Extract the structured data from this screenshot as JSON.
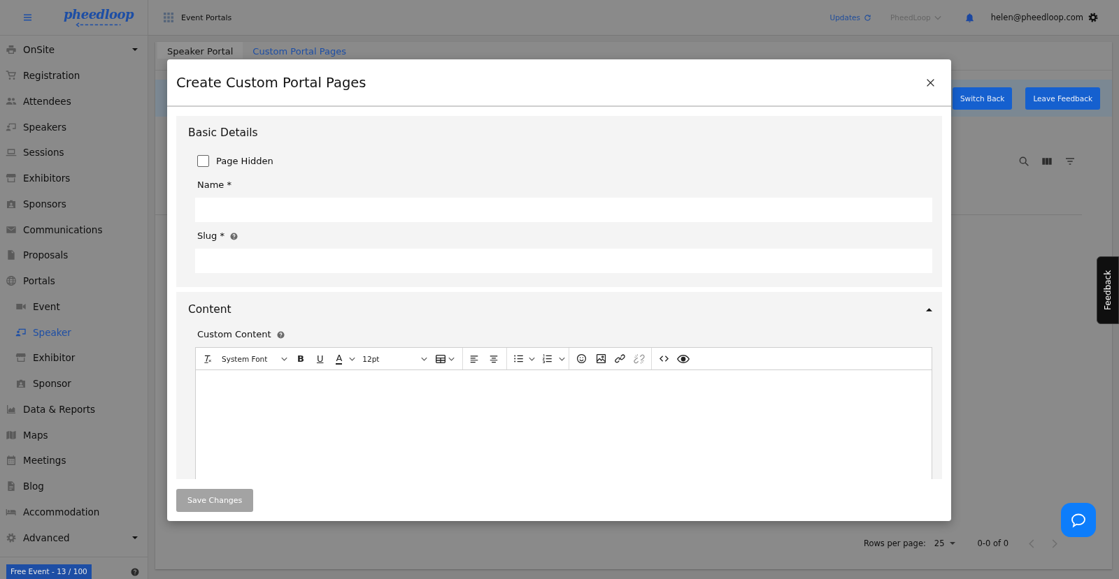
{
  "sidebar": {
    "logo": "pheedloop",
    "items": [
      {
        "label": "OnSite",
        "selected": false,
        "dropdown": true
      },
      {
        "label": "Registration",
        "selected": false,
        "dropdown": false
      },
      {
        "label": "Attendees",
        "selected": false,
        "dropdown": false
      },
      {
        "label": "Speakers",
        "selected": false,
        "dropdown": false
      },
      {
        "label": "Sessions",
        "selected": false,
        "dropdown": false
      },
      {
        "label": "Exhibitors",
        "selected": false,
        "dropdown": false
      },
      {
        "label": "Sponsors",
        "selected": false,
        "dropdown": false
      },
      {
        "label": "Communications",
        "selected": false,
        "dropdown": false
      },
      {
        "label": "Proposals",
        "selected": false,
        "dropdown": false
      },
      {
        "label": "Portals",
        "selected": false,
        "dropdown": false,
        "children": [
          {
            "label": "Event",
            "selected": false
          },
          {
            "label": "Speaker",
            "selected": true
          },
          {
            "label": "Exhibitor",
            "selected": false
          },
          {
            "label": "Sponsor",
            "selected": false
          }
        ]
      },
      {
        "label": "Data & Reports",
        "selected": false,
        "dropdown": false
      },
      {
        "label": "Maps",
        "selected": false,
        "dropdown": false
      },
      {
        "label": "Meetings",
        "selected": false,
        "dropdown": false
      },
      {
        "label": "Blog",
        "selected": false,
        "dropdown": false
      },
      {
        "label": "Accommodation",
        "selected": false,
        "dropdown": false
      },
      {
        "label": "Advanced",
        "selected": false,
        "dropdown": true
      }
    ],
    "plan_badge": "Free Event - 13 / 100"
  },
  "topbar": {
    "title": "Event Portals",
    "updates": "Updates",
    "organization": "PheedLoop",
    "user": "helen@pheedloop.com"
  },
  "page": {
    "tabs": [
      {
        "label": "Speaker Portal",
        "selected": false
      },
      {
        "label": "Custom Portal Pages",
        "selected": true
      }
    ],
    "banner_buttons": [
      "Switch Back",
      "Leave Feedback"
    ],
    "pagination": {
      "label": "Rows per page:",
      "rows": "25",
      "range": "0-0 of 0"
    }
  },
  "feedback_tab": "Feedback",
  "modal": {
    "title": "Create Custom Portal Pages",
    "basic_details": {
      "title": "Basic Details",
      "page_hidden": {
        "label": "Page Hidden",
        "checked": false
      },
      "fields": [
        {
          "label": "Name *",
          "help": false
        },
        {
          "label": "Slug *",
          "help": true
        }
      ]
    },
    "content": {
      "title": "Content",
      "expanded": true,
      "field": {
        "label": "Custom Content",
        "help": true
      },
      "editor": {
        "font": "System Font",
        "bold": "B",
        "underline": "U",
        "text_color": "A",
        "size": "12pt"
      }
    },
    "save_button": {
      "label": "Save Changes",
      "disabled": true
    }
  }
}
